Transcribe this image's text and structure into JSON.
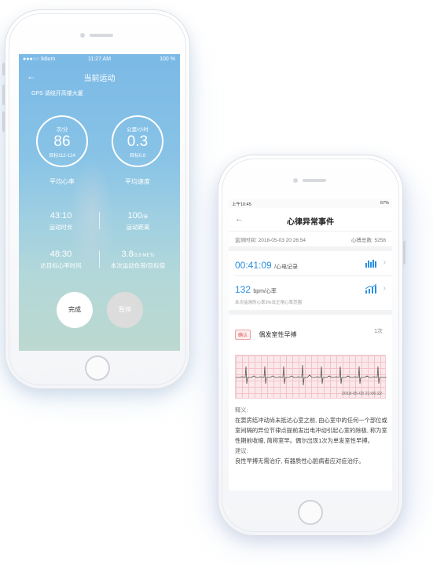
{
  "left_phone": {
    "status": {
      "carrier": "●●●○○ lidium",
      "time": "11:27 AM",
      "battery": "100 %"
    },
    "title": "当前运动",
    "gps_text": "GPS  请绕开高楼大厦",
    "heart_rate": {
      "unit": "次/分",
      "value": "86",
      "target": "目标112-124",
      "label": "平均心率"
    },
    "speed": {
      "unit": "公里/小时",
      "value": "0.3",
      "target": "目标0.8",
      "label": "平均速度"
    },
    "stats": [
      {
        "value": "43:10",
        "unit": "",
        "label": "运动时长"
      },
      {
        "value": "100",
        "unit": "/米",
        "label": "运动距离"
      },
      {
        "value": "48:30",
        "unit": "",
        "label": "达目标心率时间"
      },
      {
        "value": "3.8",
        "unit": "/3.9 METs",
        "label": "本次运动负荷/目标值"
      }
    ],
    "buttons": {
      "finish": "完成",
      "pause": "暂停"
    }
  },
  "right_phone": {
    "status": {
      "time": "上午10:45",
      "battery": "67%"
    },
    "title": "心律异常事件",
    "monitor_time": "监测时间: 2018-05-03 20:26:54",
    "heartbeat_total": "心搏总数: 5258",
    "ecg_record": {
      "value": "00:41:09",
      "label": "/心电记录"
    },
    "heart_rate": {
      "value": "132",
      "unit": "bpm/心率",
      "note": "本次监测的心率3%法正常心率范围"
    },
    "event": {
      "badge": "确认",
      "name": "偶发室性早搏",
      "count": "1次"
    },
    "ecg_timestamp": "2018-05-03 21:06:22",
    "explanation_heading": "释义:",
    "explanation": "在窦房结冲动尚未抵达心室之前, 由心室中的任何一个部位或室间隔的异位节律点提前发出电冲动引起心室的除极, 称为室性期前收缩, 简称室早。偶尔出现1次为单发室性早搏。",
    "advice_heading": "建议:",
    "advice": "良性早搏无需治疗, 有器质性心脏病者应对症治疗。"
  },
  "colors": {
    "accent_blue": "#2a8ee0",
    "alert_red": "#e25555",
    "ecg_grid": "#fbe8ea"
  }
}
